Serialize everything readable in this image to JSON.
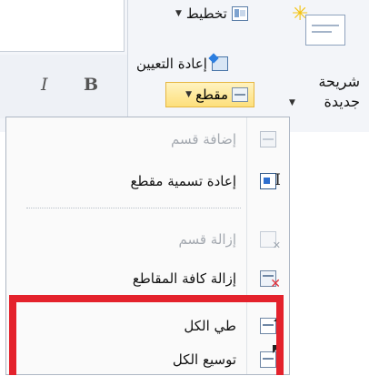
{
  "ribbon": {
    "layout_label": "تخطيط",
    "reset_label": "إعادة التعيين",
    "section_label": "مقطع",
    "new_slide_line1": "شريحة",
    "new_slide_line2": "جديدة",
    "italic_label": "I",
    "bold_label": "B"
  },
  "menu": {
    "items": [
      {
        "label": "إضافة قسم",
        "enabled": false,
        "icon": "add-section-icon"
      },
      {
        "label": "إعادة تسمية مقطع",
        "enabled": true,
        "icon": "rename-section-icon"
      },
      {
        "label": "إزالة قسم",
        "enabled": false,
        "icon": "remove-section-icon"
      },
      {
        "label": "إزالة كافة المقاطع",
        "enabled": true,
        "icon": "remove-all-sections-icon"
      },
      {
        "label": "طي الكل",
        "enabled": true,
        "icon": "collapse-all-icon"
      },
      {
        "label": "توسيع الكل",
        "enabled": true,
        "icon": "expand-all-icon"
      }
    ]
  },
  "colors": {
    "highlight": "#e4222c",
    "section_button_bg": "#fddf7b",
    "disabled_text": "#a4a9b0"
  }
}
